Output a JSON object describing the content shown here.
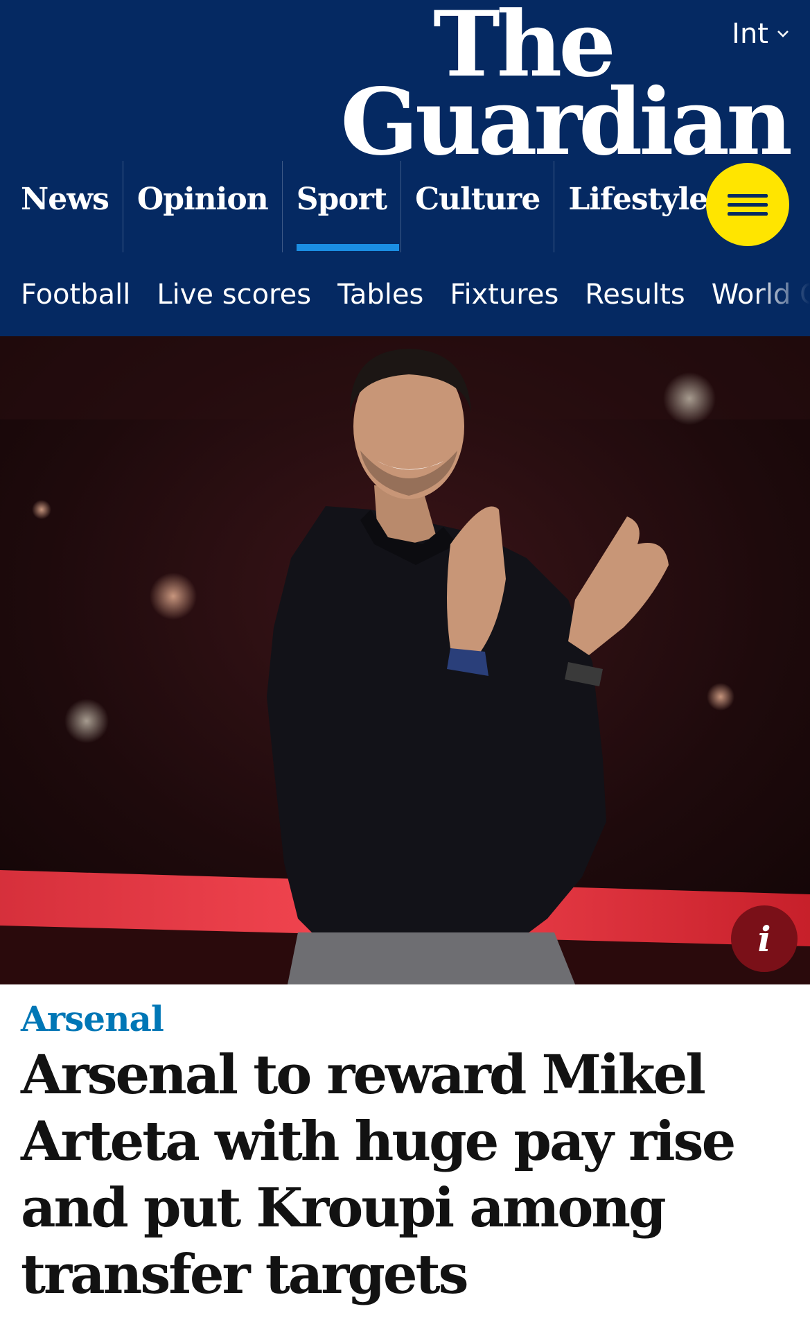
{
  "header": {
    "edition": "Int",
    "logo_line1": "The",
    "logo_line2": "Guardian",
    "pillars": [
      "News",
      "Opinion",
      "Sport",
      "Culture",
      "Lifestyle"
    ],
    "active_pillar": "Sport",
    "menu_icon": "hamburger-menu-icon"
  },
  "subnav": {
    "items": [
      "Football",
      "Live scores",
      "Tables",
      "Fixtures",
      "Results",
      "World Cup"
    ]
  },
  "hero": {
    "info_label": "i"
  },
  "article": {
    "kicker": "Arsenal",
    "headline": "Arsenal to reward Mikel Arteta with huge pay rise and put Kroupi among transfer targets"
  },
  "colors": {
    "brand_blue": "#052962",
    "menu_yellow": "#ffe500",
    "active_underline": "#1b8ee3",
    "kicker_blue": "#0077b6",
    "text": "#121212"
  }
}
